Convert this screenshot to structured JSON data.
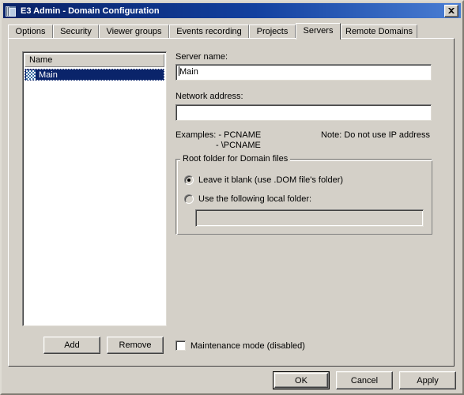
{
  "window": {
    "title": "E3 Admin - Domain Configuration",
    "icon": "server-rack-icon",
    "close_label": "close-icon",
    "colors": {
      "titlebar_start": "#0a246a",
      "titlebar_end": "#4a7ed4",
      "face": "#d4d0c8",
      "selection": "#0a246a",
      "text": "#000000"
    }
  },
  "tabs": [
    {
      "label": "Options",
      "selected": false
    },
    {
      "label": "Security",
      "selected": false
    },
    {
      "label": "Viewer groups",
      "selected": false
    },
    {
      "label": "Events recording",
      "selected": false
    },
    {
      "label": "Projects",
      "selected": false
    },
    {
      "label": "Servers",
      "selected": true
    },
    {
      "label": "Remote Domains",
      "selected": false
    }
  ],
  "servers_tab": {
    "list": {
      "column_header": "Name",
      "rows": [
        {
          "name": "Main",
          "icon": "server-item-icon",
          "selected": true
        }
      ]
    },
    "list_buttons": {
      "add_label": "Add",
      "remove_label": "Remove"
    },
    "maintenance_mode": {
      "label": "Maintenance mode (disabled)",
      "checked": false
    },
    "server_name": {
      "label": "Server name:",
      "value": "Main",
      "placeholder": ""
    },
    "network_address": {
      "label": "Network address:",
      "value": "",
      "placeholder": ""
    },
    "hints": {
      "examples_line1": "Examples: - PCNAME",
      "examples_line2": "- \\PCNAME",
      "note": "Note: Do not use IP address"
    },
    "root_folder_group": {
      "title": "Root folder for Domain files",
      "option_blank": "Leave it blank (use .DOM file's folder)",
      "option_local": "Use the following local folder:",
      "selected_option": "blank",
      "folder_value": "",
      "folder_enabled": false
    }
  },
  "dialog_buttons": {
    "ok": "OK",
    "cancel": "Cancel",
    "apply": "Apply"
  }
}
